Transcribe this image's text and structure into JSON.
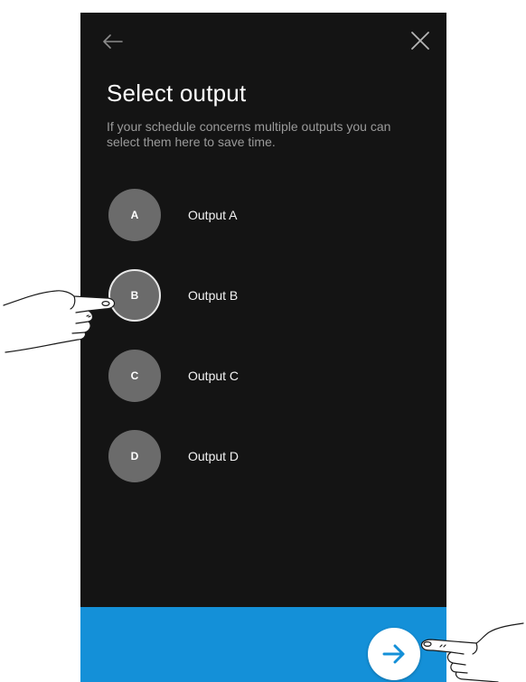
{
  "header": {
    "back_icon": "arrow-left-icon",
    "close_icon": "close-icon"
  },
  "main": {
    "title": "Select output",
    "subtitle": "If your schedule concerns multiple outputs you can select them here to save time.",
    "outputs": [
      {
        "letter": "A",
        "label": "Output A",
        "selected": false
      },
      {
        "letter": "B",
        "label": "Output B",
        "selected": true
      },
      {
        "letter": "C",
        "label": "Output C",
        "selected": false
      },
      {
        "letter": "D",
        "label": "Output D",
        "selected": false
      }
    ]
  },
  "footer": {
    "next_icon": "arrow-right-icon"
  },
  "colors": {
    "background": "#141414",
    "accent": "#1490d8",
    "circle": "#6b6b6b",
    "text": "#ffffff",
    "subtext": "#9a9a9a"
  }
}
